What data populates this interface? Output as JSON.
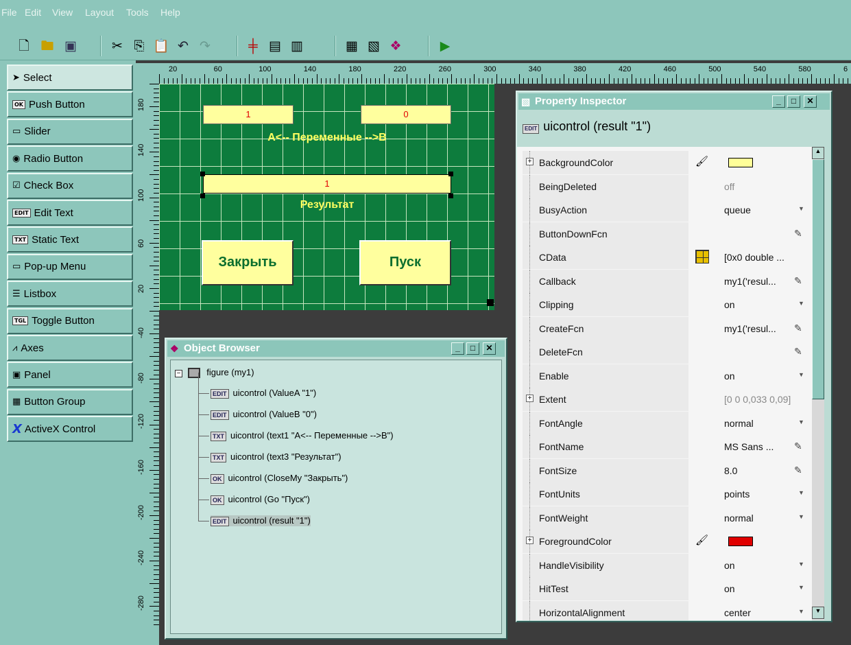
{
  "menu": [
    "File",
    "Edit",
    "View",
    "Layout",
    "Tools",
    "Help"
  ],
  "toolbar": {
    "buttons": [
      "new-icon",
      "open-icon",
      "save-icon",
      "cut-icon",
      "copy-icon",
      "paste-icon",
      "undo-icon",
      "redo-icon",
      "align-icon",
      "menu-editor-icon",
      "tab-order-icon",
      "m-file-editor-icon",
      "property-inspector-icon",
      "object-browser-icon",
      "run-icon"
    ]
  },
  "palette": {
    "items": [
      {
        "label": "Select",
        "icon": "arrow-icon"
      },
      {
        "label": "Push Button",
        "icon": "OK"
      },
      {
        "label": "Slider",
        "icon": "slider"
      },
      {
        "label": "Radio Button",
        "icon": "radio"
      },
      {
        "label": "Check Box",
        "icon": "checkbox"
      },
      {
        "label": "Edit Text",
        "icon": "EDIT"
      },
      {
        "label": "Static Text",
        "icon": "TXT"
      },
      {
        "label": "Pop-up Menu",
        "icon": "popup"
      },
      {
        "label": "Listbox",
        "icon": "listbox"
      },
      {
        "label": "Toggle Button",
        "icon": "TGL"
      },
      {
        "label": "Axes",
        "icon": "axes"
      },
      {
        "label": "Panel",
        "icon": "panel"
      },
      {
        "label": "Button Group",
        "icon": "group"
      },
      {
        "label": "ActiveX Control",
        "icon": "X"
      }
    ]
  },
  "ruler": {
    "h_labels": [
      "20",
      "60",
      "100",
      "140",
      "180",
      "220",
      "260",
      "300",
      "340",
      "380",
      "420",
      "460",
      "500",
      "540",
      "580",
      "6"
    ],
    "v_labels": [
      "180",
      "140",
      "100",
      "60",
      "20",
      "-40",
      "-80",
      "-120",
      "-160",
      "-200",
      "-240",
      "-280"
    ]
  },
  "figure": {
    "valueA": "1",
    "valueB": "0",
    "text1": "A<-- Переменные -->B",
    "result": "1",
    "text3": "Результат",
    "close_label": "Закрыть",
    "go_label": "Пуск"
  },
  "object_browser": {
    "title": "Object Browser",
    "root": "figure (my1)",
    "items": [
      {
        "icon": "EDIT",
        "label": "uicontrol (ValueA \"1\")"
      },
      {
        "icon": "EDIT",
        "label": "uicontrol (ValueB \"0\")"
      },
      {
        "icon": "TXT",
        "label": "uicontrol (text1 \"A<-- Переменные -->B\")"
      },
      {
        "icon": "TXT",
        "label": "uicontrol (text3 \"Результат\")"
      },
      {
        "icon": "OK",
        "label": "uicontrol (CloseMy \"Закрыть\")"
      },
      {
        "icon": "OK",
        "label": "uicontrol (Go \"Пуск\")"
      },
      {
        "icon": "EDIT",
        "label": "uicontrol (result \"1\")"
      }
    ]
  },
  "property_inspector": {
    "title": "Property Inspector",
    "subtitle": "uicontrol (result \"1\")",
    "colors": {
      "background": "#ffff99",
      "foreground": "#e00000"
    },
    "rows": [
      {
        "name": "BackgroundColor",
        "value": "",
        "expand": true,
        "icon": "paint-bucket-icon",
        "swatch": "#ffff99"
      },
      {
        "name": "BeingDeleted",
        "value": "off",
        "dim": true
      },
      {
        "name": "BusyAction",
        "value": "queue",
        "control": "dropdown"
      },
      {
        "name": "ButtonDownFcn",
        "value": "",
        "control": "edit"
      },
      {
        "name": "CData",
        "value": "[0x0  double ...",
        "icon": "grid-icon"
      },
      {
        "name": "Callback",
        "value": "my1('resul...",
        "control": "edit"
      },
      {
        "name": "Clipping",
        "value": "on",
        "control": "dropdown"
      },
      {
        "name": "CreateFcn",
        "value": "my1('resul...",
        "control": "edit"
      },
      {
        "name": "DeleteFcn",
        "value": "",
        "control": "edit"
      },
      {
        "name": "Enable",
        "value": "on",
        "control": "dropdown"
      },
      {
        "name": "Extent",
        "value": "[0 0 0,033 0,09]",
        "expand": true,
        "dim": true
      },
      {
        "name": "FontAngle",
        "value": "normal",
        "control": "dropdown"
      },
      {
        "name": "FontName",
        "value": "MS Sans ...",
        "control": "edit"
      },
      {
        "name": "FontSize",
        "value": "8.0",
        "control": "edit"
      },
      {
        "name": "FontUnits",
        "value": "points",
        "control": "dropdown"
      },
      {
        "name": "FontWeight",
        "value": "normal",
        "control": "dropdown"
      },
      {
        "name": "ForegroundColor",
        "value": "",
        "expand": true,
        "icon": "paint-bucket-icon",
        "swatch": "#e00000"
      },
      {
        "name": "HandleVisibility",
        "value": "on",
        "control": "dropdown"
      },
      {
        "name": "HitTest",
        "value": "on",
        "control": "dropdown"
      },
      {
        "name": "HorizontalAlignment",
        "value": "center",
        "control": "dropdown"
      }
    ]
  }
}
